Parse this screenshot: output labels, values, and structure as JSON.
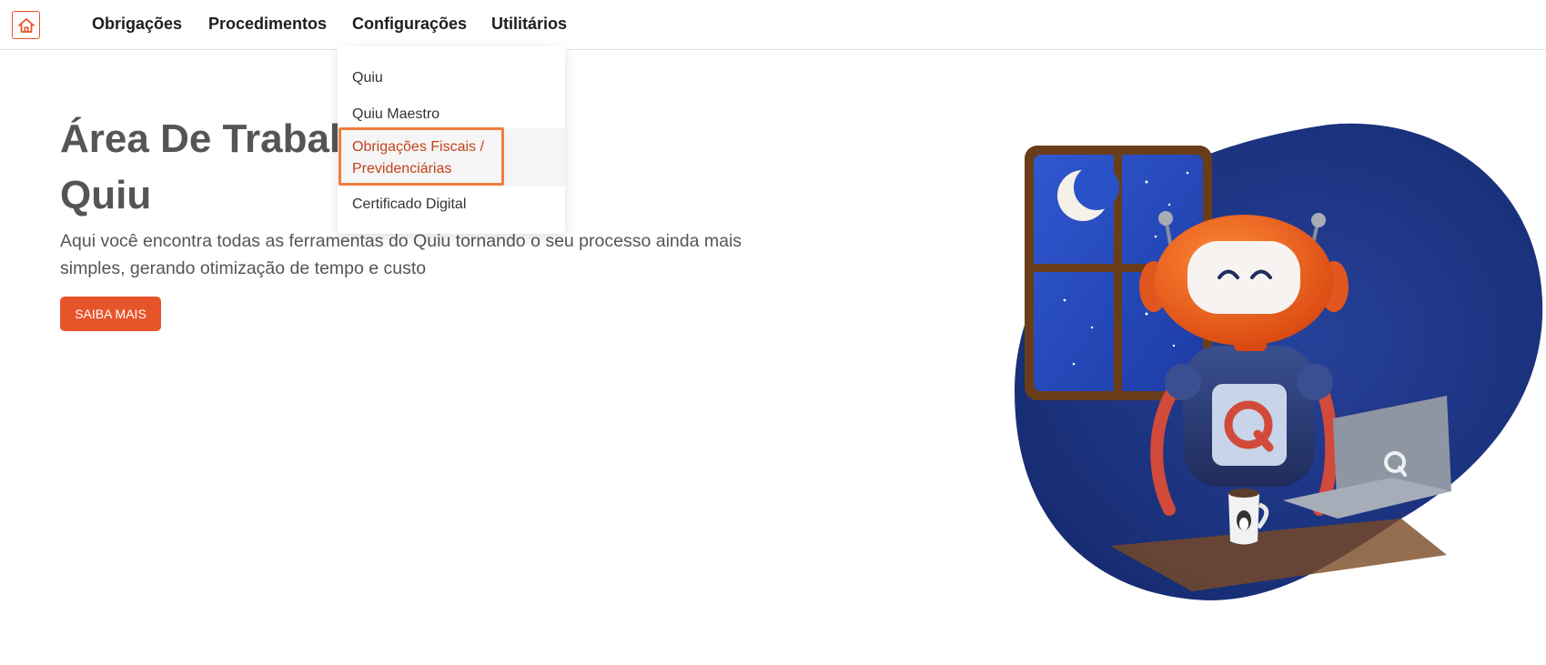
{
  "nav": {
    "home_icon": "home-icon",
    "items": [
      {
        "label": "Obrigações"
      },
      {
        "label": "Procedimentos"
      },
      {
        "label": "Configurações"
      },
      {
        "label": "Utilitários"
      }
    ]
  },
  "dropdown": {
    "items": [
      {
        "label": "Quiu"
      },
      {
        "label": "Quiu Maestro"
      },
      {
        "label_line1": "Obrigações Fiscais /",
        "label_line2": "Previdenciárias",
        "selected": true
      },
      {
        "label": "Certificado Digital"
      }
    ]
  },
  "hero": {
    "title_line1": "Área De Trabalho",
    "title_line2": "Quiu",
    "description_line1": "Aqui você encontra todas as ferramentas do Quiu tornando o seu processo ainda mais",
    "description_line2": "simples, gerando otimização de tempo e custo",
    "cta_label": "SAIBA MAIS"
  },
  "colors": {
    "accent": "#e8542a",
    "selected_text": "#c2431c",
    "highlight_border": "#f07e3c",
    "illustration_blob": "#1c2f7a"
  }
}
